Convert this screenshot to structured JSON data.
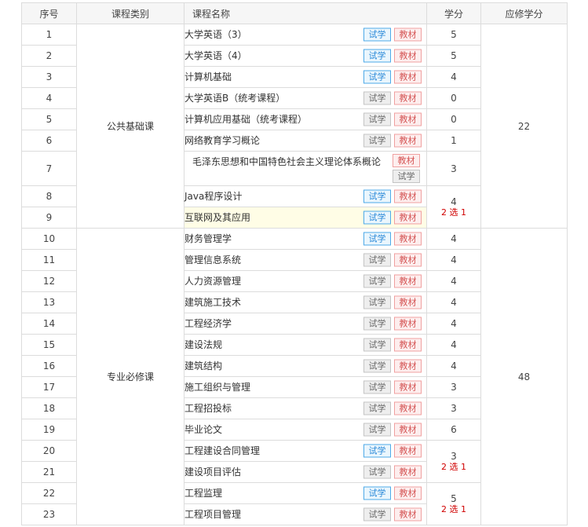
{
  "header": {
    "index": "序号",
    "category": "课程类别",
    "course_name": "课程名称",
    "credits": "学分",
    "required_credits": "应修学分"
  },
  "buttons": {
    "trial": "试学",
    "textbook": "教材"
  },
  "groups": [
    {
      "category": "公共基础课",
      "required_credits": "22",
      "courses": [
        {
          "no": "1",
          "name": "大学英语（3）",
          "credits": "5",
          "trial": "blue",
          "textbook": "red"
        },
        {
          "no": "2",
          "name": "大学英语（4）",
          "credits": "5",
          "trial": "blue",
          "textbook": "red"
        },
        {
          "no": "3",
          "name": "计算机基础",
          "credits": "4",
          "trial": "blue",
          "textbook": "red"
        },
        {
          "no": "4",
          "name": "大学英语B（统考课程）",
          "credits": "0",
          "trial": "gray",
          "textbook": "red"
        },
        {
          "no": "5",
          "name": "计算机应用基础（统考课程）",
          "credits": "0",
          "trial": "gray",
          "textbook": "red"
        },
        {
          "no": "6",
          "name": "网络教育学习概论",
          "credits": "1",
          "trial": "gray",
          "textbook": "red"
        },
        {
          "no": "7",
          "name": "毛泽东思想和中国特色社会主义理论体系概论",
          "credits": "3",
          "trial": "gray",
          "textbook": "red"
        },
        {
          "no": "8",
          "name": "Java程序设计",
          "credits": "4",
          "trial": "blue",
          "textbook": "red"
        },
        {
          "no": "9",
          "name": "互联网及其应用",
          "credits": "",
          "pick": "2 选 1",
          "trial": "blue",
          "textbook": "red"
        }
      ]
    },
    {
      "category": "专业必修课",
      "required_credits": "48",
      "courses": [
        {
          "no": "10",
          "name": "财务管理学",
          "credits": "4",
          "trial": "blue",
          "textbook": "red"
        },
        {
          "no": "11",
          "name": "管理信息系统",
          "credits": "4",
          "trial": "gray",
          "textbook": "red"
        },
        {
          "no": "12",
          "name": "人力资源管理",
          "credits": "4",
          "trial": "gray",
          "textbook": "red"
        },
        {
          "no": "13",
          "name": "建筑施工技术",
          "credits": "4",
          "trial": "gray",
          "textbook": "red"
        },
        {
          "no": "14",
          "name": "工程经济学",
          "credits": "4",
          "trial": "gray",
          "textbook": "red"
        },
        {
          "no": "15",
          "name": "建设法规",
          "credits": "4",
          "trial": "gray",
          "textbook": "red"
        },
        {
          "no": "16",
          "name": "建筑结构",
          "credits": "4",
          "trial": "gray",
          "textbook": "red"
        },
        {
          "no": "17",
          "name": "施工组织与管理",
          "credits": "3",
          "trial": "gray",
          "textbook": "red"
        },
        {
          "no": "18",
          "name": "工程招投标",
          "credits": "3",
          "trial": "gray",
          "textbook": "red"
        },
        {
          "no": "19",
          "name": "毕业论文",
          "credits": "6",
          "trial": "gray",
          "textbook": "red"
        },
        {
          "no": "20",
          "name": "工程建设合同管理",
          "credits": "3",
          "trial": "blue",
          "textbook": "red"
        },
        {
          "no": "21",
          "name": "建设项目评估",
          "credits": "",
          "pick": "2 选 1",
          "trial": "gray",
          "textbook": "red"
        },
        {
          "no": "22",
          "name": "工程监理",
          "credits": "5",
          "trial": "blue",
          "textbook": "red"
        },
        {
          "no": "23",
          "name": "工程项目管理",
          "credits": "",
          "pick": "2 选 1",
          "trial": "gray",
          "textbook": "red"
        }
      ]
    }
  ]
}
